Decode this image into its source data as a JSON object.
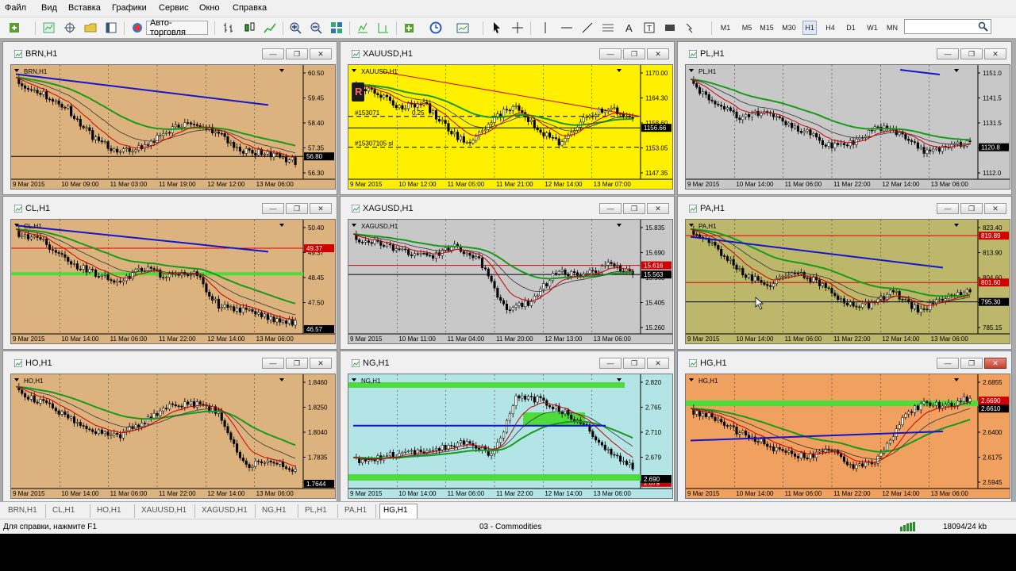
{
  "menu": [
    "Файл",
    "Вид",
    "Вставка",
    "Графики",
    "Сервис",
    "Окно",
    "Справка"
  ],
  "toolbar": {
    "autotrade_label": "Авто-торговля",
    "timeframes": [
      "M1",
      "M5",
      "M15",
      "M30",
      "H1",
      "H4",
      "D1",
      "W1",
      "MN"
    ],
    "active_timeframe": "H1"
  },
  "windows": [
    {
      "title": "BRN,H1",
      "label": "BRN,H1",
      "bg": "#dcb37e",
      "ticks": [
        "60.50",
        "59.45",
        "58.40",
        "57.35",
        "56.30"
      ],
      "price": "56.80",
      "price_color": "#000000",
      "dates": [
        "9 Mar 2015",
        "10 Mar 09:00",
        "11 Mar 03:00",
        "11 Mar 19:00",
        "12 Mar 12:00",
        "13 Mar 06:00"
      ],
      "close_red": false
    },
    {
      "title": "XAUUSD,H1",
      "label": "XAUUSD,H1",
      "bg": "#fff000",
      "ticks": [
        "1170.00",
        "1164.30",
        "1158.60",
        "1153.05",
        "1147.35"
      ],
      "price": "1156.66",
      "price_color": "#000000",
      "dates": [
        "9 Mar 2015",
        "10 Mar 12:00",
        "11 Mar 05:00",
        "11 Mar 21:00",
        "12 Mar 14:00",
        "13 Mar 07:00"
      ],
      "close_red": false,
      "badge": "R",
      "annotations": [
        "#153071",
        "0.25",
        "#15307105 sl"
      ]
    },
    {
      "title": "PL,H1",
      "label": "PL,H1",
      "bg": "#c8c8c8",
      "ticks": [
        "1151.0",
        "1141.5",
        "1131.5",
        "1121.8",
        "1112.0"
      ],
      "price": "1120.8",
      "price_color": "#000000",
      "dates": [
        "9 Mar 2015",
        "10 Mar 14:00",
        "11 Mar 06:00",
        "11 Mar 22:00",
        "12 Mar 14:00",
        "13 Mar 06:00"
      ],
      "close_red": false
    },
    {
      "title": "CL,H1",
      "label": "CL,H1",
      "bg": "#dcb37e",
      "ticks": [
        "50.40",
        "49.37",
        "48.45",
        "47.50",
        "46.57"
      ],
      "price": "46.57",
      "price_color": "#000000",
      "extra_prices": [
        {
          "value": "49.37",
          "color": "#d00000"
        }
      ],
      "dates": [
        "9 Mar 2015",
        "10 Mar 14:00",
        "11 Mar 06:00",
        "11 Mar 22:00",
        "12 Mar 14:00",
        "13 Mar 06:00"
      ],
      "close_red": false
    },
    {
      "title": "XAGUSD,H1",
      "label": "XAGUSD,H1",
      "bg": "#c8c8c8",
      "ticks": [
        "15.835",
        "15.690",
        "15.563",
        "15.405",
        "15.260"
      ],
      "price": "15.563",
      "price_color": "#000000",
      "extra_prices": [
        {
          "value": "15.616",
          "color": "#d00000"
        }
      ],
      "dates": [
        "9 Mar 2015",
        "10 Mar 11:00",
        "11 Mar 04:00",
        "11 Mar 20:00",
        "12 Mar 13:00",
        "13 Mar 06:00"
      ],
      "close_red": false
    },
    {
      "title": "PA,H1",
      "label": "PA,H1",
      "bg": "#bdb76b",
      "ticks": [
        "823.40",
        "813.90",
        "804.60",
        "795.30",
        "785.15"
      ],
      "price": "795.30",
      "price_color": "#000000",
      "extra_prices": [
        {
          "value": "819.89",
          "color": "#d00000"
        },
        {
          "value": "801.60",
          "color": "#d00000"
        }
      ],
      "dates": [
        "9 Mar 2015",
        "10 Mar 14:00",
        "11 Mar 06:00",
        "11 Mar 22:00",
        "12 Mar 14:00",
        "13 Mar 06:00"
      ],
      "close_red": false
    },
    {
      "title": "HO,H1",
      "label": "HO,H1",
      "bg": "#dcb37e",
      "ticks": [
        "1.8460",
        "1.8250",
        "1.8040",
        "1.7835",
        "1.7644"
      ],
      "price": "1.7644",
      "price_color": "#000000",
      "dates": [
        "9 Mar 2015",
        "10 Mar 14:00",
        "11 Mar 06:00",
        "11 Mar 22:00",
        "12 Mar 14:00",
        "13 Mar 06:00"
      ],
      "close_red": false
    },
    {
      "title": "NG,H1",
      "label": "NG,H1",
      "bg": "#b4e5e6",
      "ticks": [
        "2.820",
        "2.765",
        "2.710",
        "2.679",
        "2.655"
      ],
      "price": "2.690",
      "price_color": "#000000",
      "extra_prices": [
        {
          "value": "2.679",
          "color": "#d00000"
        }
      ],
      "dates": [
        "9 Mar 2015",
        "10 Mar 14:00",
        "11 Mar 06:00",
        "11 Mar 22:00",
        "12 Mar 14:00",
        "13 Mar 06:00"
      ],
      "close_red": false
    },
    {
      "title": "HG,H1",
      "label": "HG,H1",
      "bg": "#f0a15f",
      "ticks": [
        "2.6855",
        "2.6610",
        "2.6400",
        "2.6175",
        "2.5945"
      ],
      "price": "2.6610",
      "price_color": "#000000",
      "extra_prices": [
        {
          "value": "2.6690",
          "color": "#d00000"
        }
      ],
      "dates": [
        "9 Mar 2015",
        "10 Mar 14:00",
        "11 Mar 06:00",
        "11 Mar 22:00",
        "12 Mar 14:00",
        "13 Mar 06:00"
      ],
      "close_red": true
    }
  ],
  "tabs": [
    "BRN,H1",
    "CL,H1",
    "HO,H1",
    "XAUUSD,H1",
    "XAGUSD,H1",
    "NG,H1",
    "PL,H1",
    "PA,H1",
    "HG,H1"
  ],
  "active_tab": "HG,H1",
  "status": {
    "help": "Для справки, нажмите F1",
    "profile": "03 - Commodities",
    "traffic": "18094/24 kb"
  }
}
